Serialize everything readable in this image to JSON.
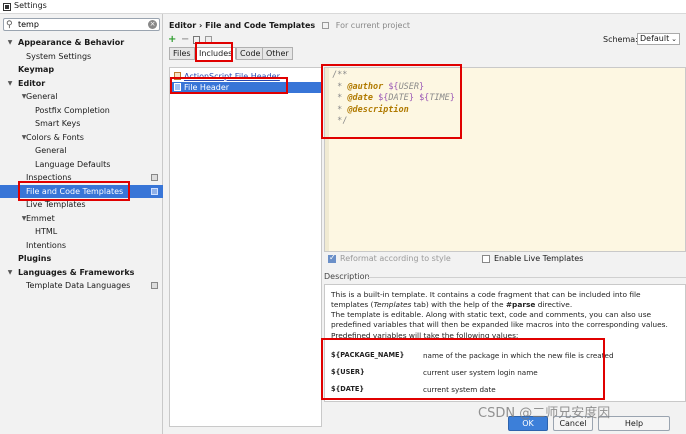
{
  "window": {
    "title": "Settings"
  },
  "search": {
    "value": "temp"
  },
  "tree": [
    {
      "label": "Appearance & Behavior",
      "level": 0,
      "expanded": true,
      "bold": true
    },
    {
      "label": "System Settings",
      "level": 1
    },
    {
      "label": "Keymap",
      "level": 0,
      "bold": true
    },
    {
      "label": "Editor",
      "level": 0,
      "expanded": true,
      "bold": true
    },
    {
      "label": "General",
      "level": 1,
      "expanded": true
    },
    {
      "label": "Postfix Completion",
      "level": 2
    },
    {
      "label": "Smart Keys",
      "level": 2
    },
    {
      "label": "Colors & Fonts",
      "level": 1,
      "expanded": true
    },
    {
      "label": "General",
      "level": 2
    },
    {
      "label": "Language Defaults",
      "level": 2
    },
    {
      "label": "Inspections",
      "level": 1,
      "project": true
    },
    {
      "label": "File and Code Templates",
      "level": 1,
      "project": true,
      "selected": true
    },
    {
      "label": "Live Templates",
      "level": 1
    },
    {
      "label": "Emmet",
      "level": 1,
      "expanded": true
    },
    {
      "label": "HTML",
      "level": 2
    },
    {
      "label": "Intentions",
      "level": 1
    },
    {
      "label": "Plugins",
      "level": 0,
      "bold": true
    },
    {
      "label": "Languages & Frameworks",
      "level": 0,
      "expanded": true,
      "bold": true
    },
    {
      "label": "Template Data Languages",
      "level": 1,
      "project": true
    }
  ],
  "header": {
    "breadcrumb": "Editor › File and Code Templates",
    "scope": "For current project"
  },
  "schema": {
    "label": "Schema:",
    "value": "Default"
  },
  "tabs": [
    {
      "label": "Files"
    },
    {
      "label": "Includes",
      "active": true
    },
    {
      "label": "Code"
    },
    {
      "label": "Other"
    }
  ],
  "templates": [
    {
      "label": "ActionScript File Header"
    },
    {
      "label": "File Header",
      "selected": true
    }
  ],
  "editor": {
    "open": "/**",
    "author_tag": "@author",
    "author_var": "USER",
    "date_tag": "@date",
    "date_var1": "DATE",
    "date_var2": "TIME",
    "desc_tag": "@description",
    "close": "*/"
  },
  "options": {
    "reformat": "Reformat according to style",
    "live": "Enable Live Templates"
  },
  "description": {
    "heading": "Description",
    "p1_pre": "This is a built-in template. It contains a code fragment that can be included into file templates (",
    "p1_em": "Templates",
    "p1_mid": " tab) with the help of the ",
    "p1_strong": "#parse",
    "p1_post": " directive.",
    "p2": "The template is editable. Along with static text, code and comments, you can also use predefined variables that will then be expanded like macros into the corresponding values.",
    "p3": "Predefined variables will take the following values:",
    "vars": [
      {
        "key": "${PACKAGE_NAME}",
        "value": "name of the package in which the new file is created"
      },
      {
        "key": "${USER}",
        "value": "current user system login name"
      },
      {
        "key": "${DATE}",
        "value": "current system date"
      }
    ]
  },
  "buttons": {
    "ok": "OK",
    "cancel": "Cancel",
    "help": "Help"
  },
  "watermark": "CSDN @二师兄安度因"
}
